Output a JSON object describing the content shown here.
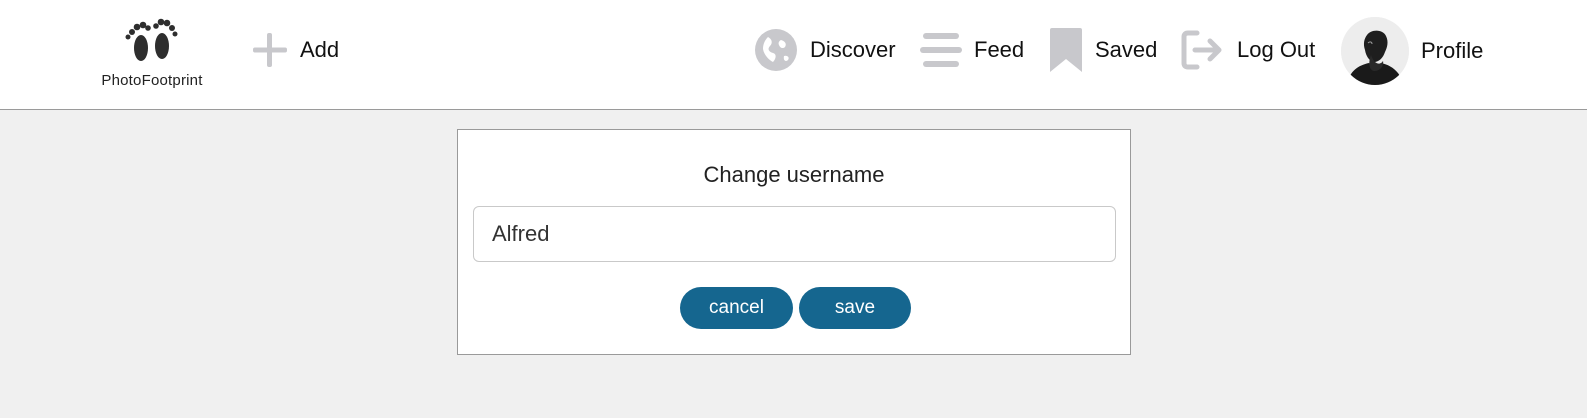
{
  "app": {
    "name": "PhotoFootprint"
  },
  "header": {
    "add_label": "Add",
    "nav": {
      "discover": "Discover",
      "feed": "Feed",
      "saved": "Saved",
      "logout": "Log Out",
      "profile": "Profile"
    }
  },
  "dialog": {
    "title": "Change username",
    "username_value": "Alfred",
    "cancel_label": "cancel",
    "save_label": "save"
  },
  "colors": {
    "accent": "#15668f",
    "icon_gray": "#c8c8cc",
    "page_background": "#f0f0f0"
  },
  "icons": [
    "footprints-logo-icon",
    "plus-icon",
    "globe-icon",
    "menu-lines-icon",
    "bookmark-icon",
    "logout-icon",
    "profile-avatar"
  ]
}
